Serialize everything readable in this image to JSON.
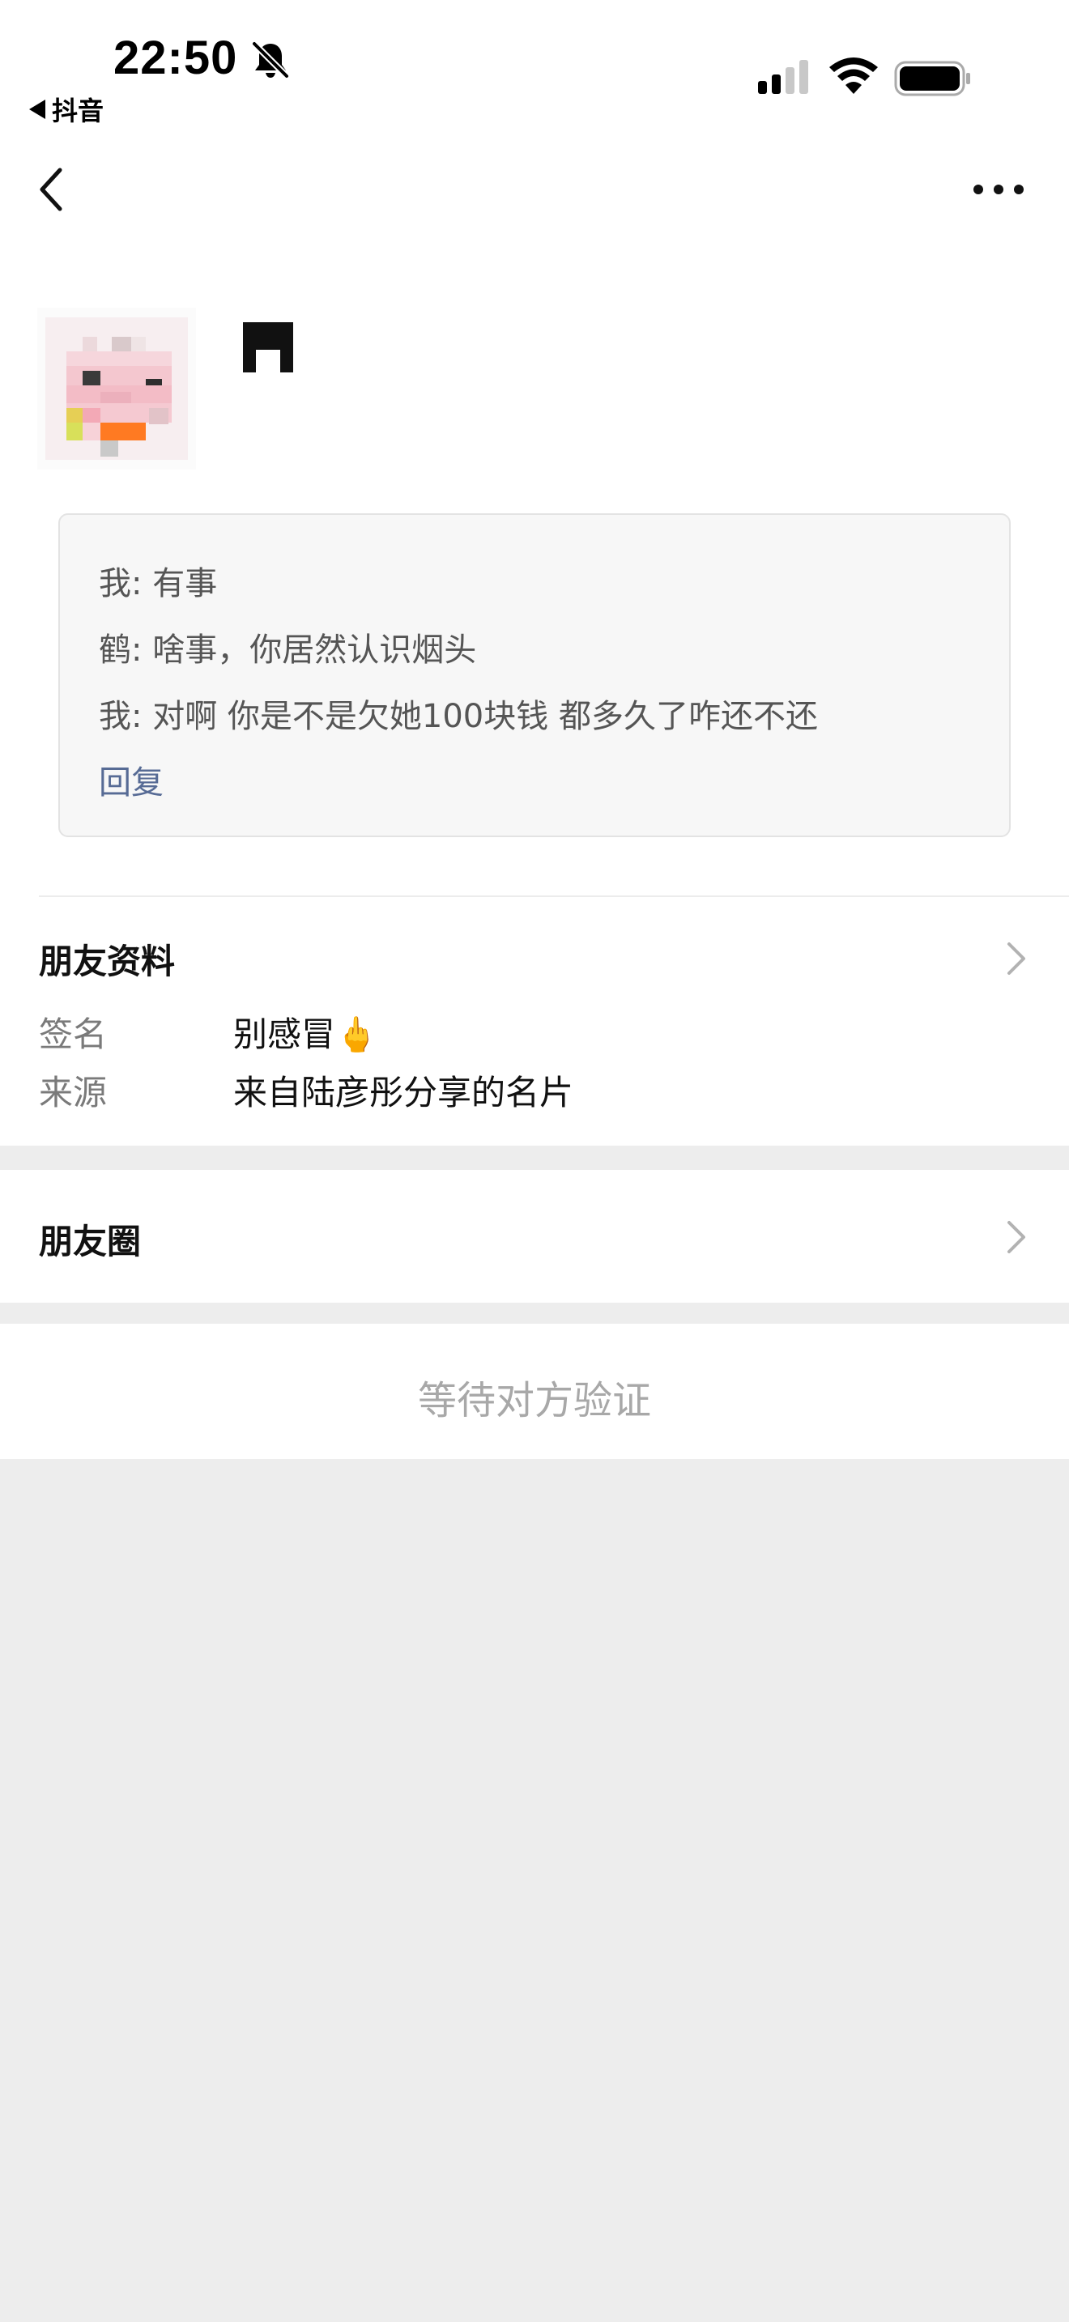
{
  "status_bar": {
    "time": "22:50",
    "back_app": "抖音"
  },
  "icons": {
    "bell": "bell-slash-icon",
    "signal": "cellular-signal-icon",
    "wifi": "wifi-icon",
    "battery": "battery-icon",
    "back": "chevron-left-icon",
    "more": "more-dots-icon",
    "chevron": "chevron-right-icon"
  },
  "messages": [
    "我: 有事",
    "鹤: 啥事，你居然认识烟头",
    "我: 对啊 你是不是欠她100块钱 都多久了咋还不还"
  ],
  "reply_label": "回复",
  "friend_info": {
    "title": "朋友资料",
    "signature_label": "签名",
    "signature_value": "别感冒🖕",
    "source_label": "来源",
    "source_value": "来自陆彦彤分享的名片"
  },
  "moments": {
    "title": "朋友圈"
  },
  "pending": {
    "label": "等待对方验证"
  },
  "colors": {
    "link": "#576b95",
    "pending_text": "#a8a8a8",
    "background": "#ededed"
  }
}
